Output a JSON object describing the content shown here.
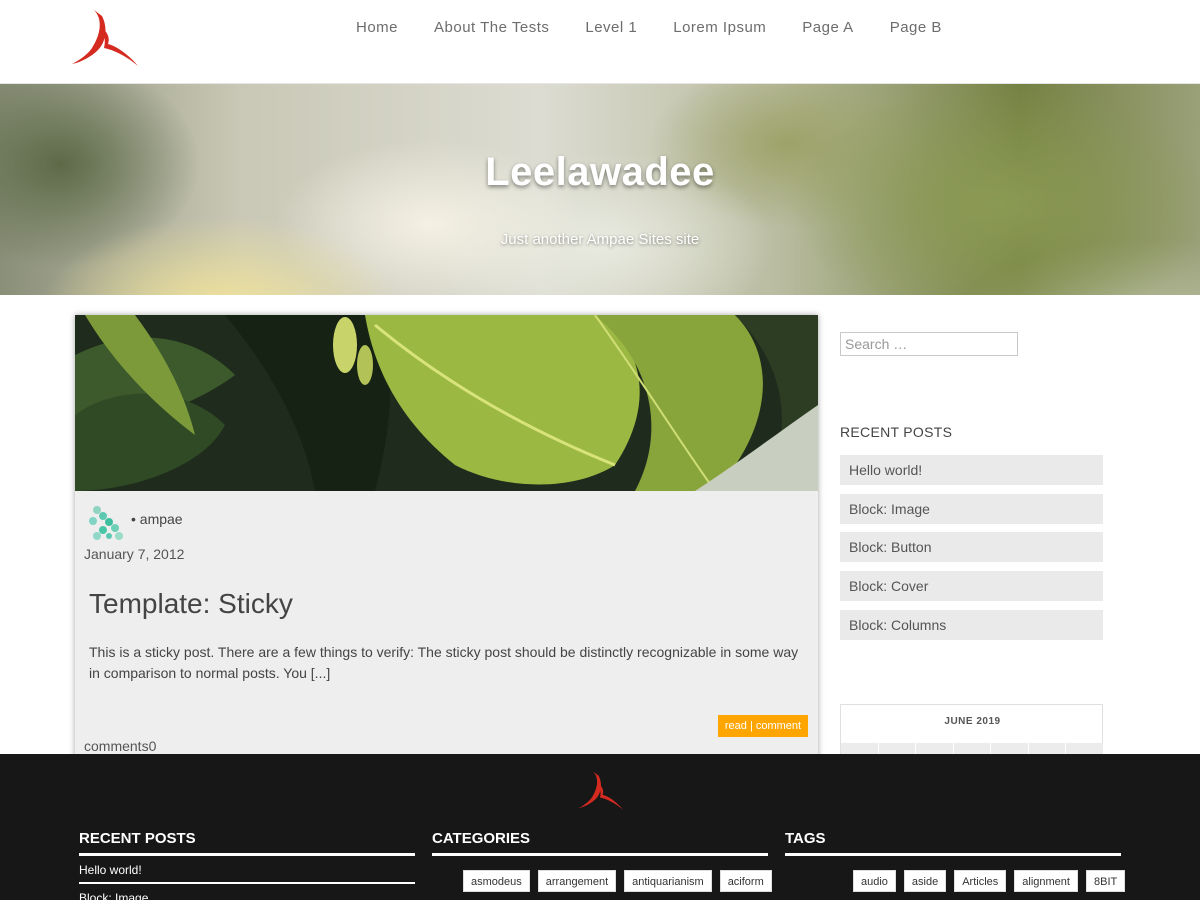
{
  "nav": {
    "logo_icon": "ampae-logo-icon",
    "items": [
      {
        "label": "Home"
      },
      {
        "label": "About The Tests"
      },
      {
        "label": "Level 1"
      },
      {
        "label": "Lorem Ipsum"
      },
      {
        "label": "Page A"
      },
      {
        "label": "Page B"
      }
    ]
  },
  "hero": {
    "title": "Leelawadee",
    "subtitle": "Just another Ampae Sites site"
  },
  "post": {
    "author": "• ampae",
    "date": "January 7, 2012",
    "title": "Template: Sticky",
    "excerpt": "This is a sticky post. There are a few things to verify: The sticky post should be distinctly recognizable in some way in comparison to normal posts. You [...]",
    "read_label": "read | comment",
    "comments": "comments0"
  },
  "sidebar": {
    "search_placeholder": "Search …",
    "recent_heading": "RECENT POSTS",
    "recent_posts": [
      {
        "label": "Hello world!"
      },
      {
        "label": "Block: Image"
      },
      {
        "label": "Block: Button"
      },
      {
        "label": "Block: Cover"
      },
      {
        "label": "Block: Columns"
      }
    ],
    "calendar_caption": "JUNE 2019"
  },
  "footer": {
    "recent_heading": "RECENT POSTS",
    "recent_posts": [
      {
        "label": "Hello world!"
      },
      {
        "label": "Block: Image"
      }
    ],
    "categories_heading": "CATEGORIES",
    "categories": [
      {
        "label": "asmodeus"
      },
      {
        "label": "arrangement"
      },
      {
        "label": "antiquarianism"
      },
      {
        "label": "aciform"
      }
    ],
    "tags_heading": "TAGS",
    "tags": [
      {
        "label": "audio"
      },
      {
        "label": "aside"
      },
      {
        "label": "Articles"
      },
      {
        "label": "alignment"
      },
      {
        "label": "8BIT"
      }
    ]
  },
  "colors": {
    "accent": "#ffa500",
    "logo_red": "#d42a20",
    "footer_bg": "#171717"
  }
}
